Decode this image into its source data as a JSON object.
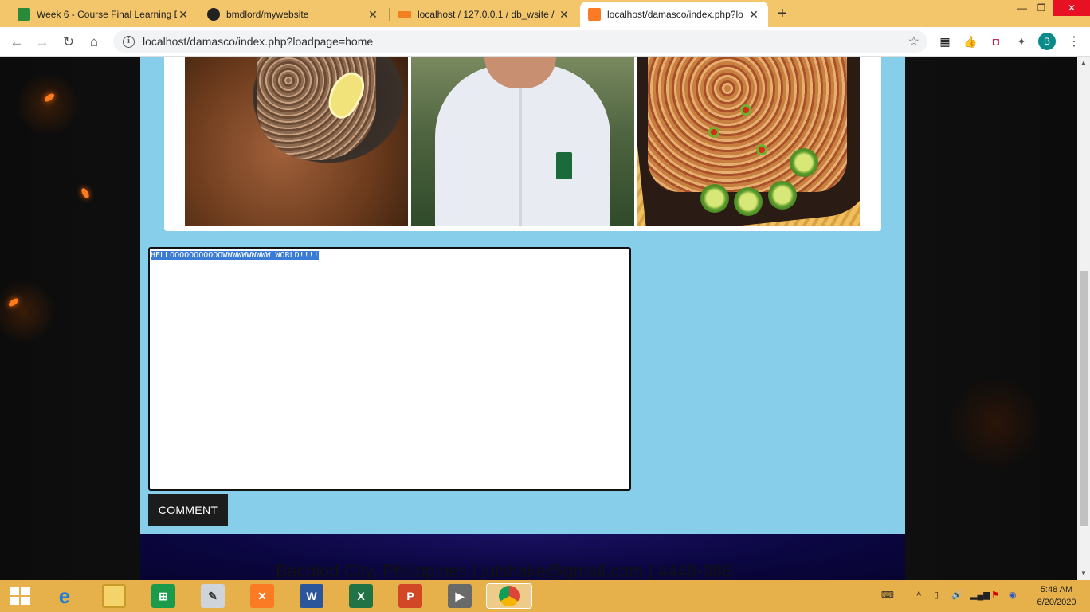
{
  "browser": {
    "tabs": [
      {
        "title": "Week 6 - Course Final Learning E",
        "favicon": "lasalle-icon",
        "active": false
      },
      {
        "title": "bmdlord/mywebsite",
        "favicon": "github-icon",
        "active": false
      },
      {
        "title": "localhost / 127.0.0.1 / db_wsite /",
        "favicon": "phpmyadmin-icon",
        "active": false
      },
      {
        "title": "localhost/damasco/index.php?lo",
        "favicon": "xampp-icon",
        "active": true
      }
    ],
    "address": "localhost/damasco/index.php?loadpage=home",
    "profile_initial": "B"
  },
  "page": {
    "comment_text": "HELLOOOOOOOOOOOWWWWWWWWWW WORLD!!!!",
    "comment_button": "COMMENT",
    "footer": "Bacolod City, Philippines | julshake@gmail.com | 4448-086"
  },
  "taskbar": {
    "apps": [
      "internet-explorer",
      "file-explorer",
      "store",
      "notepad",
      "xampp",
      "word",
      "excel",
      "powerpoint",
      "video",
      "chrome"
    ],
    "time": "5:48 AM",
    "date": "6/20/2020"
  },
  "colors": {
    "tabstrip": "#f3c66b",
    "panel": "#87ceeb",
    "taskbar": "#e6b04a",
    "selection": "#3a7bd5"
  }
}
